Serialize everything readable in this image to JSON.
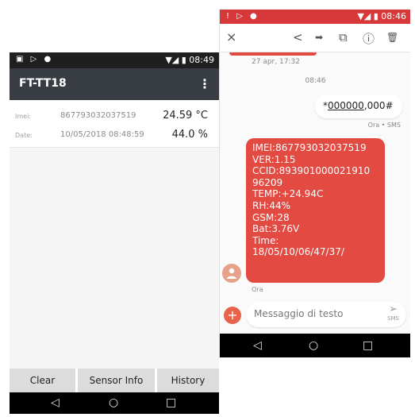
{
  "left_phone": {
    "status_bar": {
      "left_icons": "▣ ▷ ●",
      "right_icons": "▼◢ ▮",
      "time": "08:49"
    },
    "app_bar": {
      "title": "FT-TT18",
      "menu_icon": "⋮"
    },
    "readings": {
      "imei_label": "Imei:",
      "imei_value": "867793032037519",
      "temperature": "24.59 °C",
      "date_label": "Date:",
      "date_value": "10/05/2018 08:48:59",
      "humidity": "44.0 %"
    },
    "buttons": {
      "clear": "Clear",
      "sensor_info": "Sensor Info",
      "history": "History"
    },
    "nav": {
      "back": "◁",
      "home": "○",
      "recents": "□"
    }
  },
  "right_phone": {
    "status_bar": {
      "left_icons": "! ▷ ●",
      "right_icons": "▼◢ ▮",
      "time": "08:46"
    },
    "toolbar": {
      "close": "×",
      "share": "<",
      "forward": "➡",
      "copy": "⧉",
      "info": "ⓘ",
      "delete": "🗑"
    },
    "thread": {
      "earlier_timestamp": "27 apr, 17:32",
      "time_divider": "08:46",
      "outgoing": {
        "prefix": "*",
        "underlined": "000000",
        "suffix": ",000#",
        "meta": "Ora • SMS"
      },
      "incoming": {
        "lines": [
          "IMEI:867793032037519",
          "VER:1.15",
          "CCID:893901000021910",
          "96209",
          "TEMP:+24.94C",
          "RH:44%",
          "GSM:28",
          "Bat:3.76V",
          "Time:",
          "18/05/10/06/47/37/"
        ],
        "meta": "Ora"
      }
    },
    "compose": {
      "placeholder": "Messaggio di testo",
      "plus": "+",
      "send_arrow": "➢",
      "send_label": "SMS"
    },
    "nav": {
      "back": "◁",
      "home": "○",
      "recents": "□"
    }
  },
  "colors": {
    "left_appbar": "#373d42",
    "right_statusbar": "#d7393a",
    "incoming_bubble": "#e24a42",
    "avatar": "#e6a189"
  }
}
